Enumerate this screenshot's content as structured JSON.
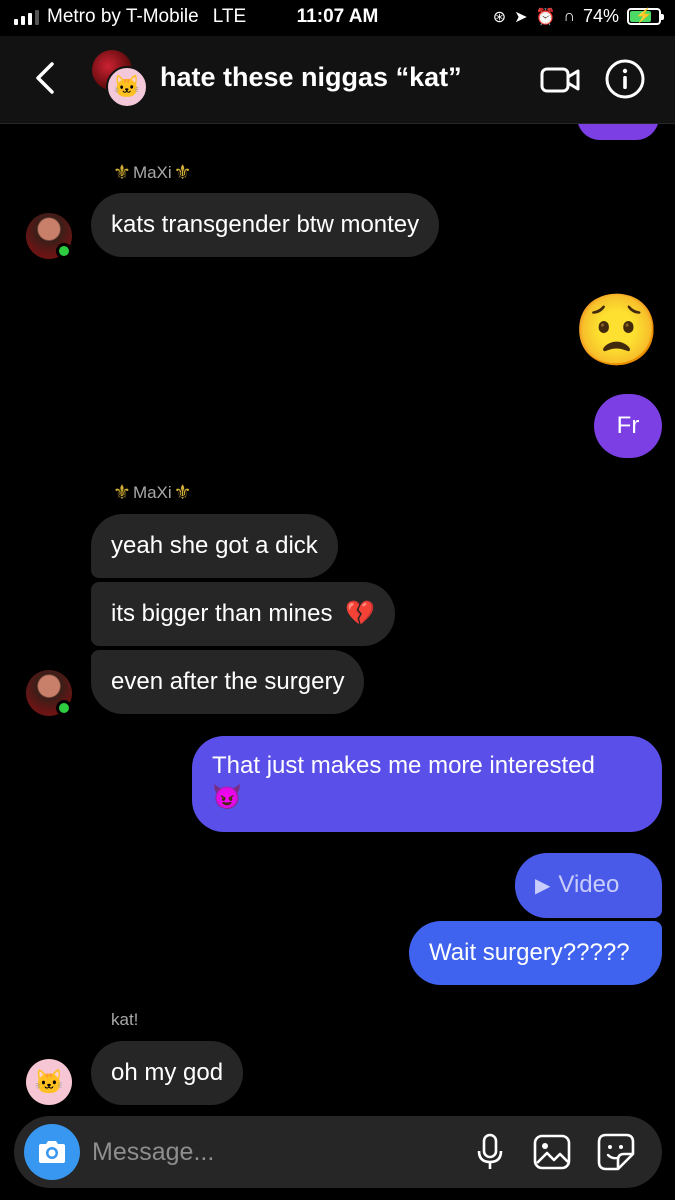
{
  "status_bar": {
    "carrier": "Metro by T-Mobile",
    "network": "LTE",
    "time": "11:07 AM",
    "battery_percent": "74%",
    "battery_level": 0.74,
    "icons": [
      "signal-icon",
      "screen-lock-icon",
      "location-icon",
      "alarm-icon",
      "headphones-icon",
      "battery-charging-icon"
    ]
  },
  "header": {
    "title": "hate these niggas “kat”",
    "icons": [
      "back-chevron-icon",
      "video-camera-icon",
      "info-icon"
    ]
  },
  "messages": {
    "m1": {
      "sender": "MaXi",
      "text": "kats transgender btw montey"
    },
    "m2": {
      "emoji": "😟"
    },
    "m3": {
      "text": "Fr"
    },
    "m4": {
      "sender": "MaXi",
      "text": "yeah she got a dick"
    },
    "m5": {
      "text": "its bigger than mines",
      "emoji": "💔"
    },
    "m6": {
      "text": "even after the surgery"
    },
    "m7": {
      "text": "That just makes me more interested",
      "emoji": "😈"
    },
    "m8": {
      "text": "Video"
    },
    "m9": {
      "text": "Wait surgery?????"
    },
    "m10": {
      "sender": "kat!",
      "text": "oh my god"
    }
  },
  "composer": {
    "placeholder": "Message...",
    "icons": [
      "camera-icon",
      "microphone-icon",
      "gallery-icon",
      "sticker-icon"
    ]
  },
  "colors": {
    "background": "#000000",
    "incoming_bubble": "#262626",
    "outgoing_purple": "#7b3fe4",
    "outgoing_indigo": "#5b4fe9",
    "outgoing_blue": "#3f63ee",
    "camera_button": "#3897f0",
    "online_dot": "#2ecc40"
  }
}
